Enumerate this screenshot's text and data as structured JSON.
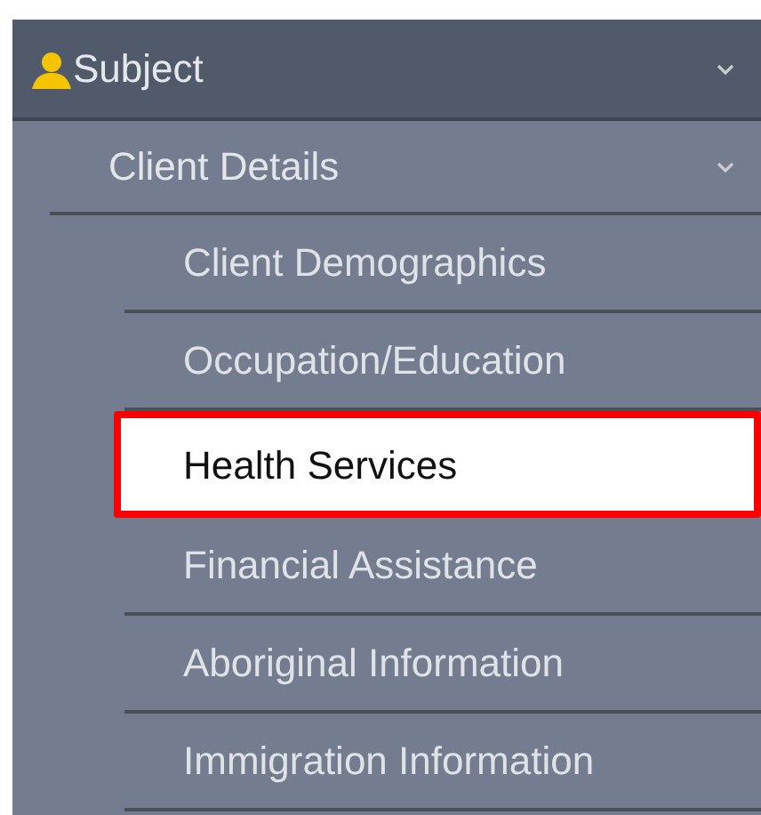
{
  "menu": {
    "label": "Subject",
    "expanded": true,
    "group": {
      "label": "Client Details",
      "expanded": true,
      "items": [
        {
          "label": "Client Demographics",
          "selected": false
        },
        {
          "label": "Occupation/Education",
          "selected": false
        },
        {
          "label": "Health Services",
          "selected": true
        },
        {
          "label": "Financial Assistance",
          "selected": false
        },
        {
          "label": "Aboriginal Information",
          "selected": false
        },
        {
          "label": "Immigration Information",
          "selected": false
        }
      ]
    }
  }
}
